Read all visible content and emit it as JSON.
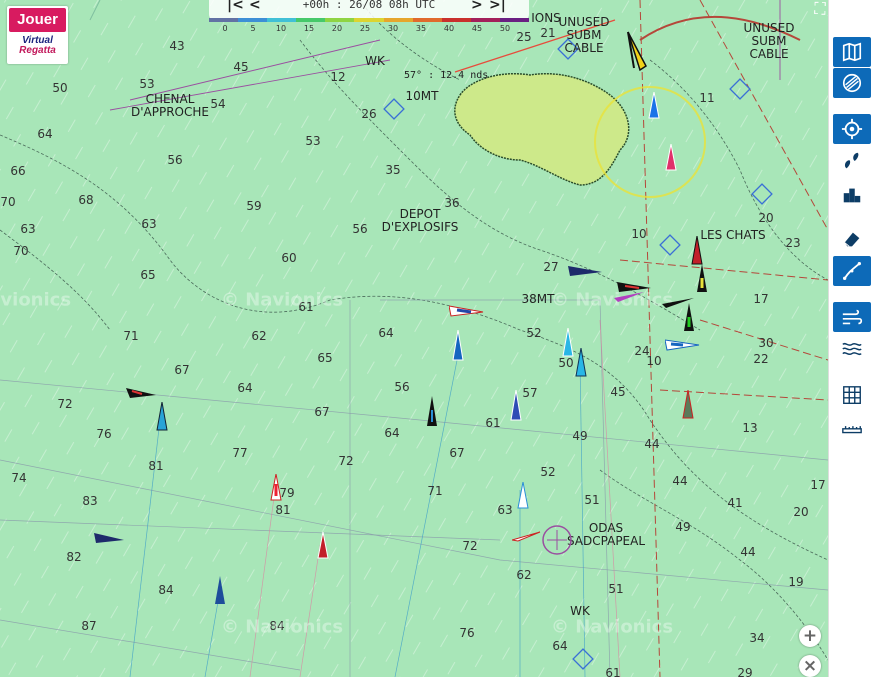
{
  "app": {
    "play_label": "Jouer",
    "brand_line1": "Virtual",
    "brand_line2": "Regatta"
  },
  "timebar": {
    "time_label": "+00h : 26/08 08h UTC",
    "prev_far": "|<",
    "prev": "<",
    "next": ">",
    "next_far": ">|",
    "wind_scale": [
      "0",
      "5",
      "10",
      "15",
      "20",
      "25",
      "30",
      "35",
      "40",
      "45",
      "50"
    ],
    "wind_colors": [
      "#6272a4",
      "#3d8fd6",
      "#41c0d6",
      "#46c96a",
      "#8fd443",
      "#dcd431",
      "#e6a62c",
      "#e06a2c",
      "#c9302c",
      "#a3205a",
      "#6a1f82"
    ]
  },
  "route": {
    "heading_label": "57° : 12.4 nds"
  },
  "map": {
    "depths": [
      {
        "t": "43"
      },
      {
        "t": "45"
      },
      {
        "t": "50"
      },
      {
        "t": "53"
      },
      {
        "t": "54"
      },
      {
        "t": "64"
      },
      {
        "t": "56"
      },
      {
        "t": "66"
      },
      {
        "t": "68"
      },
      {
        "t": "70"
      },
      {
        "t": "63"
      },
      {
        "t": "63"
      },
      {
        "t": "70"
      },
      {
        "t": "59"
      },
      {
        "t": "65"
      },
      {
        "t": "60"
      },
      {
        "t": "56"
      },
      {
        "t": "53"
      },
      {
        "t": "26"
      },
      {
        "t": "35"
      },
      {
        "t": "36"
      },
      {
        "t": "27"
      },
      {
        "t": "10"
      },
      {
        "t": "11"
      },
      {
        "t": "20"
      },
      {
        "t": "23"
      },
      {
        "t": "17"
      },
      {
        "t": "30"
      },
      {
        "t": "22"
      },
      {
        "t": "24"
      },
      {
        "t": "10"
      },
      {
        "t": "61"
      },
      {
        "t": "62"
      },
      {
        "t": "64"
      },
      {
        "t": "65"
      },
      {
        "t": "52"
      },
      {
        "t": "50"
      },
      {
        "t": "45"
      },
      {
        "t": "71"
      },
      {
        "t": "67"
      },
      {
        "t": "64"
      },
      {
        "t": "56"
      },
      {
        "t": "72"
      },
      {
        "t": "76"
      },
      {
        "t": "81"
      },
      {
        "t": "77"
      },
      {
        "t": "67"
      },
      {
        "t": "64"
      },
      {
        "t": "57"
      },
      {
        "t": "61"
      },
      {
        "t": "49"
      },
      {
        "t": "67"
      },
      {
        "t": "72"
      },
      {
        "t": "74"
      },
      {
        "t": "83"
      },
      {
        "t": "79"
      },
      {
        "t": "81"
      },
      {
        "t": "71"
      },
      {
        "t": "52"
      },
      {
        "t": "44"
      },
      {
        "t": "44"
      },
      {
        "t": "41"
      },
      {
        "t": "13"
      },
      {
        "t": "17"
      },
      {
        "t": "20"
      },
      {
        "t": "63"
      },
      {
        "t": "51"
      },
      {
        "t": "49"
      },
      {
        "t": "44"
      },
      {
        "t": "82"
      },
      {
        "t": "72"
      },
      {
        "t": "62"
      },
      {
        "t": "84"
      },
      {
        "t": "87"
      },
      {
        "t": "84"
      },
      {
        "t": "76"
      },
      {
        "t": "64"
      },
      {
        "t": "51"
      },
      {
        "t": "34"
      },
      {
        "t": "29"
      },
      {
        "t": "61"
      },
      {
        "t": "19"
      },
      {
        "t": "12"
      },
      {
        "t": "21"
      },
      {
        "t": "25"
      }
    ],
    "labels": [
      {
        "t": "CHENAL\nD'APPROCHE"
      },
      {
        "t": "DEPOT\nD'EXPLOSIFS"
      },
      {
        "t": "LES CHATS"
      },
      {
        "t": "38MT"
      },
      {
        "t": "10MT"
      },
      {
        "t": "UNUSED\nSUBM\nCABLE"
      },
      {
        "t": "UNUSED\nSUBM\nCABLE"
      },
      {
        "t": "ODAS\nSADCPAPEAL"
      },
      {
        "t": "WK"
      },
      {
        "t": "WK"
      },
      {
        "t": "IONS"
      }
    ],
    "watermarks": [
      "© Navionics",
      "© Navionics",
      "© Navionics",
      "© Navionics",
      "© Navionics"
    ]
  },
  "sidebar": {
    "buttons": [
      {
        "name": "map-layers-button",
        "icon": "map-icon",
        "active": true
      },
      {
        "name": "sail-layer-button",
        "icon": "sail-icon",
        "active": true
      },
      {
        "name": "center-boat-button",
        "icon": "crosshair-icon",
        "active": true
      },
      {
        "name": "trace-button",
        "icon": "footprints-icon",
        "active": false
      },
      {
        "name": "ranking-button",
        "icon": "podium-icon",
        "active": false
      },
      {
        "name": "eraser-button",
        "icon": "eraser-icon",
        "active": false
      },
      {
        "name": "route-button",
        "icon": "route-icon",
        "active": true
      },
      {
        "name": "wind-button",
        "icon": "wind-icon",
        "active": true
      },
      {
        "name": "waves-button",
        "icon": "waves-icon",
        "active": false
      },
      {
        "name": "grid-button",
        "icon": "grid-icon",
        "active": false
      },
      {
        "name": "ruler-button",
        "icon": "ruler-icon",
        "active": false
      }
    ]
  },
  "zoom": {
    "in": "+",
    "out": "×"
  }
}
